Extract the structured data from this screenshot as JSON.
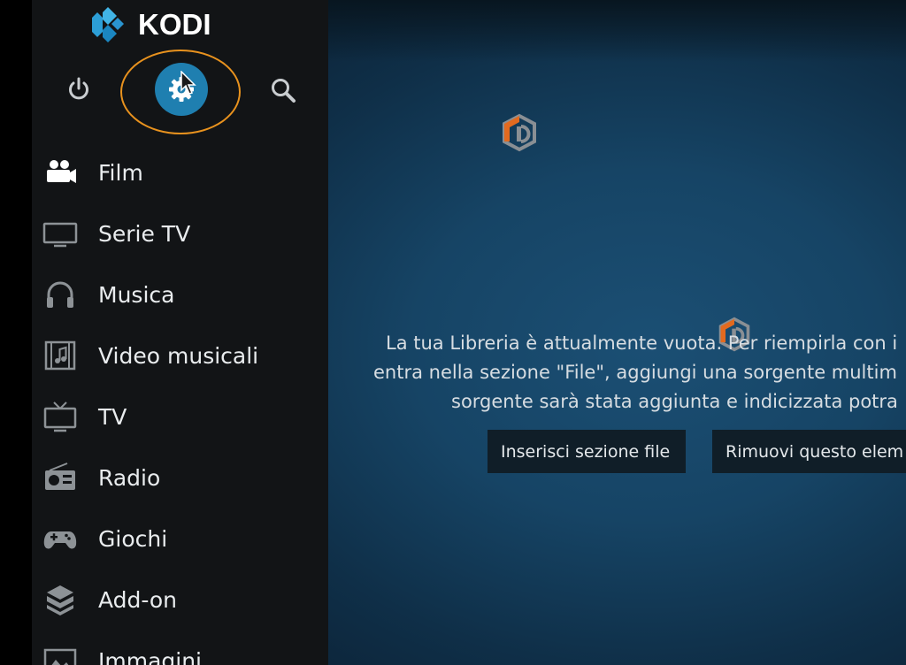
{
  "app": {
    "name": "KODI",
    "brand_color": "#1f7fb0",
    "highlight_color": "#e8921e",
    "watermark_colors": [
      "#e26a1f",
      "#8a8f94"
    ]
  },
  "topbar": {
    "power": "power-icon",
    "settings": "gear-icon",
    "search": "search-icon"
  },
  "menu": [
    {
      "label": "Film",
      "icon": "film-camera-icon"
    },
    {
      "label": "Serie TV",
      "icon": "tv-monitor-icon"
    },
    {
      "label": "Musica",
      "icon": "headphones-icon"
    },
    {
      "label": "Video musicali",
      "icon": "music-video-icon"
    },
    {
      "label": "TV",
      "icon": "tv-antenna-icon"
    },
    {
      "label": "Radio",
      "icon": "radio-icon"
    },
    {
      "label": "Giochi",
      "icon": "gamepad-icon"
    },
    {
      "label": "Add-on",
      "icon": "addon-box-icon"
    },
    {
      "label": "Immagini",
      "icon": "pictures-icon"
    }
  ],
  "main": {
    "message_lines": [
      "La tua Libreria è attualmente vuota. Per riempirla con i",
      "entra nella sezione \"File\", aggiungi una sorgente multim",
      "sorgente sarà stata aggiunta e indicizzata potra"
    ],
    "buttons": {
      "add_source": "Inserisci sezione file",
      "remove": "Rimuovi questo elem"
    }
  }
}
